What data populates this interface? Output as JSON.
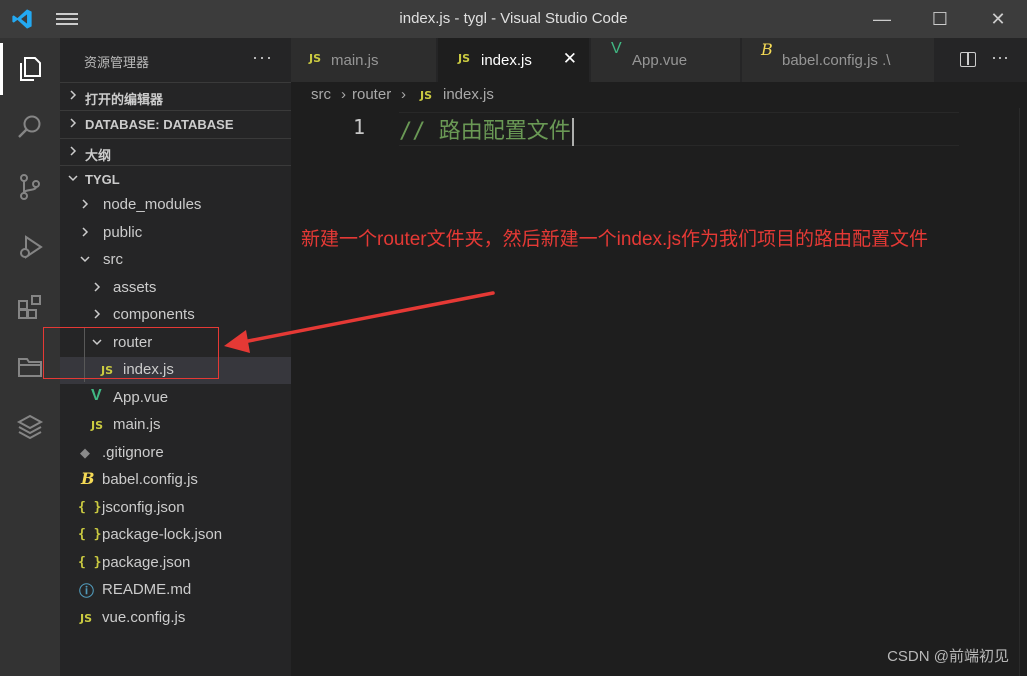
{
  "window": {
    "title": "index.js - tygl - Visual Studio Code",
    "minimize": "—",
    "maximize": "☐",
    "close": "✕"
  },
  "activity_bar": {
    "items": [
      "explorer",
      "search",
      "source-control",
      "run-and-debug",
      "extensions",
      "remote-explorer",
      "layers"
    ]
  },
  "sidebar": {
    "header": "资源管理器",
    "more": "···",
    "sections": {
      "open_editors": "打开的编辑器",
      "database": "DATABASE: DATABASE",
      "outline": "大纲",
      "project": "TYGL"
    },
    "tree": {
      "node_modules": "node_modules",
      "public": "public",
      "src": "src",
      "assets": "assets",
      "components": "components",
      "router": "router",
      "router_index": "index.js",
      "app_vue": "App.vue",
      "main_js": "main.js",
      "gitignore": ".gitignore",
      "babel_config": "babel.config.js",
      "jsconfig": "jsconfig.json",
      "package_lock": "package-lock.json",
      "package_json": "package.json",
      "readme": "README.md",
      "vue_config": "vue.config.js"
    },
    "icons": {
      "js": "JS",
      "json": "{ }",
      "info": "ⓘ",
      "babel": "B",
      "git": "◆",
      "vue": "V"
    }
  },
  "tabs": [
    {
      "label": "main.js",
      "icon": "JS"
    },
    {
      "label": "index.js",
      "icon": "JS",
      "close": "✕"
    },
    {
      "label": "App.vue",
      "icon": "V"
    },
    {
      "label": "babel.config.js .\\",
      "icon": "B"
    }
  ],
  "tab_actions": {
    "more": "···"
  },
  "breadcrumb": {
    "src": "src",
    "router": "router",
    "file": "index.js",
    "sep": "›",
    "icon": "JS"
  },
  "editor": {
    "line_number": "1",
    "code": "// 路由配置文件"
  },
  "annotation": {
    "text": "新建一个router文件夹，然后新建一个index.js作为我们项目的路由配置文件",
    "color": "#e53935"
  },
  "watermark": "CSDN @前端初见",
  "colors": {
    "accent_js": "#cbcb41",
    "vue": "#41b883",
    "comment": "#6a9955",
    "annotation": "#e53935"
  }
}
